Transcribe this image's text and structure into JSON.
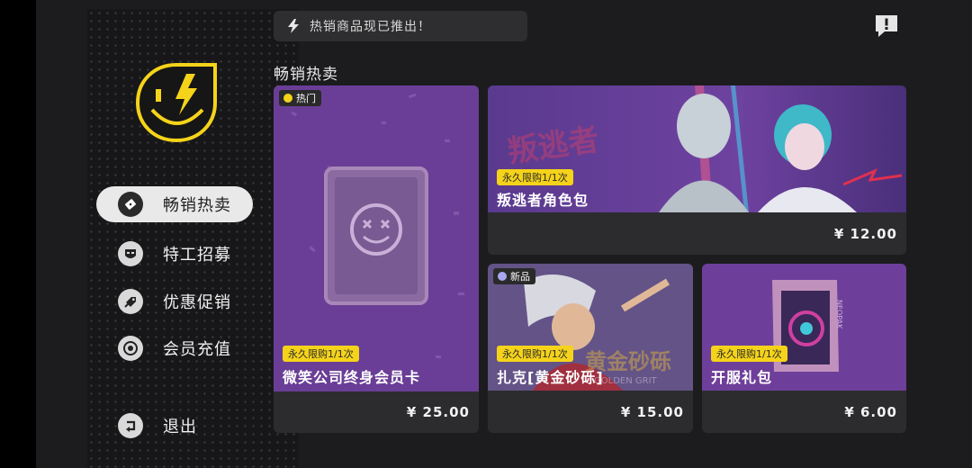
{
  "notice": {
    "text": "热销商品现已推出！"
  },
  "section": {
    "title": "畅销热卖"
  },
  "sidebar": {
    "items": [
      {
        "label": "畅销热卖",
        "active": true
      },
      {
        "label": "特工招募",
        "active": false
      },
      {
        "label": "优惠促销",
        "active": false
      },
      {
        "label": "会员充值",
        "active": false
      },
      {
        "label": "退出",
        "active": false
      }
    ]
  },
  "cards": [
    {
      "name": "微笑公司终身会员卡",
      "limit": "永久限购1/1次",
      "price": "¥ 25.00",
      "tag": "热门"
    },
    {
      "name": "叛逃者角色包",
      "limit": "永久限购1/1次",
      "price": "¥ 12.00",
      "art_text": "叛逃者"
    },
    {
      "name": "扎克[黄金砂砾]",
      "limit": "永久限购1/1次",
      "price": "¥ 15.00",
      "tag": "新品",
      "art_text": "黄金砂砾",
      "art_subtext": "GOLDEN GRIT"
    },
    {
      "name": "开服礼包",
      "limit": "永久限购1/1次",
      "price": "¥ 6.00",
      "art_text": "NEOPAK"
    }
  ],
  "colors": {
    "accent_yellow": "#f5d31a",
    "card_purple": "#6e3f9a",
    "tag_new_dot": "#a9a6f0",
    "active_nav_bg": "#e9e9e9"
  },
  "icons": {
    "notice": "lightning-icon",
    "alert": "exclamation-chat-icon",
    "logo": "smiley-lightning-logo",
    "nav": [
      "ticket-icon",
      "agent-mask-icon",
      "coupon-tag-icon",
      "coin-icon",
      "exit-arrow-icon"
    ]
  }
}
